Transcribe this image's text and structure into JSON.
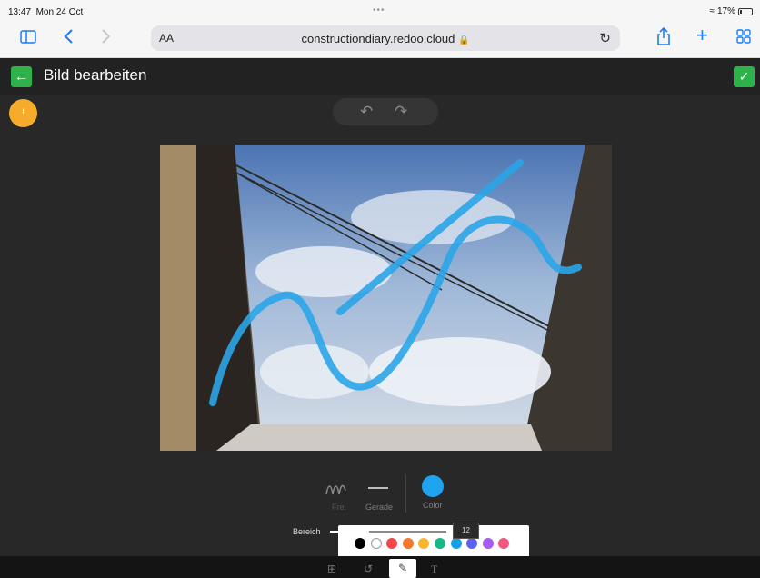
{
  "status": {
    "time": "13:47",
    "date": "Mon 24 Oct",
    "dots": "•••",
    "battery": "17%"
  },
  "browser": {
    "aa": "AA",
    "url": "constructiondiary.redoo.cloud"
  },
  "header": {
    "title": "Bild bearbeiten"
  },
  "palette": {
    "colors": [
      "#000000",
      "#ffffff",
      "#f04848",
      "#f5782a",
      "#f6b62e",
      "#1bb58a",
      "#12a1e3",
      "#5b63ee",
      "#a75bf0",
      "#f2557d"
    ]
  },
  "tools": {
    "frei": "Frei",
    "gerade": "Gerade",
    "color": "Color",
    "selected_color": "#1ea3ee"
  },
  "slider": {
    "label": "Bereich",
    "value": "12",
    "fraction": 0.3
  },
  "accent": {
    "green": "#2db34a",
    "orange": "#f6ac2a"
  }
}
